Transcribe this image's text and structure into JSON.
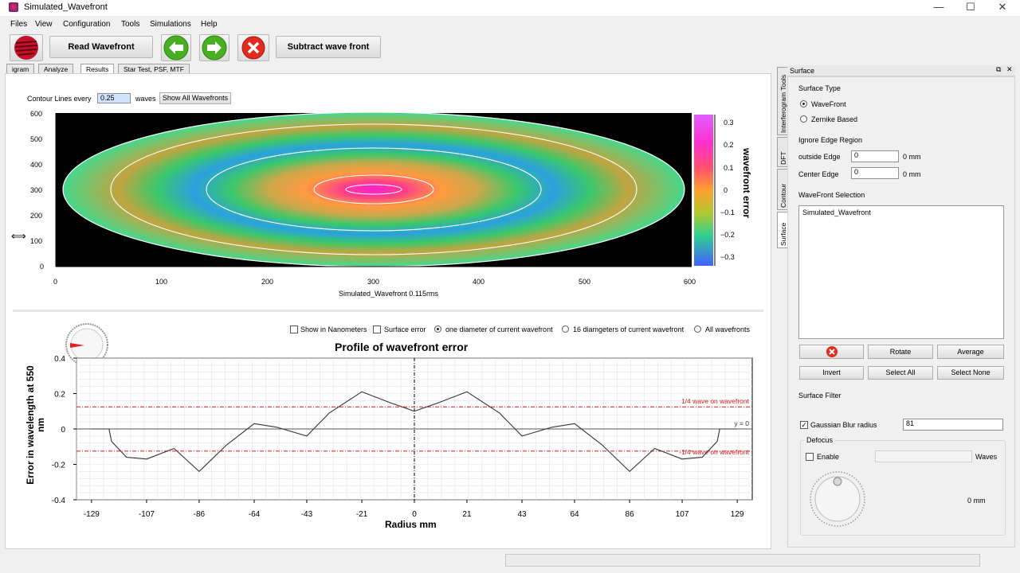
{
  "window": {
    "title": "Simulated_Wavefront",
    "minimize": "—",
    "maximize": "☐",
    "close": "✕"
  },
  "menu": [
    "Files",
    "View",
    "Configuration",
    "Tools",
    "Simulations",
    "Help"
  ],
  "toolbar": {
    "read_wavefront": "Read Wavefront",
    "subtract_wavefront": "Subtract wave front"
  },
  "tabs": [
    "igram",
    "Analyze",
    "Results",
    "Star Test, PSF, MTF"
  ],
  "active_tab": "Results",
  "contour": {
    "label": "Contour Lines every",
    "value": "0.25",
    "units": "waves",
    "show_all_button": "Show All Wavefronts",
    "x_ticks": [
      "0",
      "100",
      "200",
      "300",
      "400",
      "500",
      "600"
    ],
    "y_ticks": [
      "600",
      "500",
      "400",
      "300",
      "200",
      "100",
      "0"
    ],
    "caption": "Simulated_Wavefront  0.115rms",
    "colorbar_ticks": [
      "0.3",
      "0.2",
      "0.1",
      "0",
      "−0.1",
      "−0.2",
      "−0.3"
    ],
    "colorbar_label": "wavefront error"
  },
  "profile_options": {
    "show_nm": "Show in Nanometers",
    "surface_error": "Surface error",
    "one_diameter": "one diameter of current wavefront",
    "sixteen_diameters": "16 diamgeters of current wavefront",
    "all_wavefronts": "All wavefronts"
  },
  "chart_data": {
    "type": "line",
    "title": "Profile of wavefront error",
    "xlabel": "Radius mm",
    "ylabel": "Error in wavelength at 550 nm",
    "xlim": [
      -135,
      135
    ],
    "ylim": [
      -0.4,
      0.4
    ],
    "x_ticks": [
      -129,
      -107,
      -86,
      -64,
      -43,
      -21,
      0,
      21,
      43,
      64,
      86,
      107,
      129
    ],
    "y_ticks": [
      0.4,
      0.2,
      0,
      -0.2,
      -0.4
    ],
    "annotations": [
      {
        "text": "1/4 wave on wavefront",
        "y": 0.125
      },
      {
        "text": "-1/4 wave on wavefront",
        "y": -0.125
      },
      {
        "text": "y = 0",
        "y": 0
      }
    ],
    "series": [
      {
        "x": [
          -129,
          -122,
          -121,
          -115,
          -107,
          -96,
          -86,
          -75,
          -64,
          -55,
          -43,
          -34,
          -21,
          -10,
          0,
          10,
          21,
          34,
          43,
          55,
          64,
          75,
          86,
          96,
          107,
          115,
          121,
          122,
          129
        ],
        "values": [
          0,
          0,
          -0.07,
          -0.16,
          -0.17,
          -0.11,
          -0.24,
          -0.09,
          0.03,
          0.01,
          -0.04,
          0.09,
          0.21,
          0.15,
          0.1,
          0.15,
          0.21,
          0.09,
          -0.04,
          0.01,
          0.03,
          -0.09,
          -0.24,
          -0.11,
          -0.17,
          -0.16,
          -0.07,
          0,
          0
        ]
      }
    ]
  },
  "side": {
    "header": "Surface",
    "vtabs": [
      "Interferogram Tools",
      "DFT",
      "Contour",
      "Surface"
    ],
    "surface_type_label": "Surface Type",
    "opt_wavefront": "WaveFront",
    "opt_zernike": "Zernike Based",
    "ignore_edge_label": "Ignore Edge Region",
    "outside_edge_label": "outside Edge",
    "outside_edge_value": "0",
    "center_edge_label": "Center Edge",
    "center_edge_value": "0",
    "mm": "0 mm",
    "wf_selection_label": "WaveFront Selection",
    "wf_list": [
      "Simulated_Wavefront"
    ],
    "rotate": "Rotate",
    "average": "Average",
    "invert": "Invert",
    "select_all": "Select All",
    "select_none": "Select None",
    "surface_filter_label": "Surface Filter",
    "gaussian_label": "Gaussian Blur radius",
    "gaussian_value": "81",
    "defocus_label": "Defocus",
    "enable_label": "Enable",
    "waves_label": "Waves",
    "dial_value": "0  mm"
  }
}
